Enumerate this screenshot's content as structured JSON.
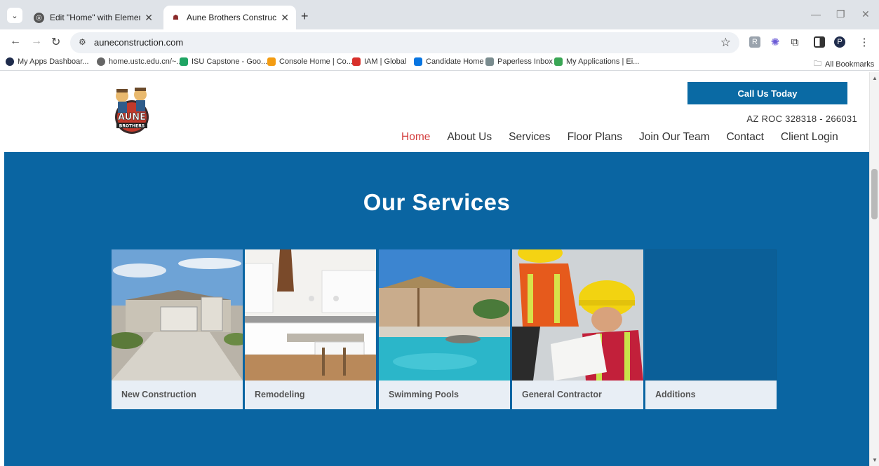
{
  "browser": {
    "tabs": [
      {
        "title": "Edit \"Home\" with Elementor",
        "active": false
      },
      {
        "title": "Aune Brothers Construction",
        "active": true
      }
    ],
    "url": "auneconstruction.com",
    "profile_initial": "P",
    "bookmarks": [
      {
        "label": "My Apps Dashboar...",
        "icon": "circle-icon",
        "color": "#1f2c4c"
      },
      {
        "label": "home.ustc.edu.cn/~...",
        "icon": "globe-icon",
        "color": "#666666"
      },
      {
        "label": "ISU Capstone - Goo...",
        "icon": "drive-icon",
        "color": "#1fa463"
      },
      {
        "label": "Console Home | Co...",
        "icon": "cube-icon",
        "color": "#f39c12"
      },
      {
        "label": "IAM | Global",
        "icon": "iam-icon",
        "color": "#d8302b"
      },
      {
        "label": "Candidate Home",
        "icon": "workday-icon",
        "color": "#0875e1"
      },
      {
        "label": "Paperless Inbox",
        "icon": "paperless-icon",
        "color": "#7a8c8f"
      },
      {
        "label": "My Applications | Ei...",
        "icon": "app-icon",
        "color": "#3aa655"
      }
    ],
    "all_bookmarks_label": "All Bookmarks"
  },
  "site": {
    "logo_text": "AUNE BROTHERS",
    "cta_label": "Call Us Today",
    "license": "AZ ROC 328318 - 266031",
    "nav": [
      "Home",
      "About Us",
      "Services",
      "Floor Plans",
      "Join Our Team",
      "Contact",
      "Client Login"
    ],
    "active_nav": "Home"
  },
  "services": {
    "heading": "Our Services",
    "cards": [
      {
        "label": "New Construction"
      },
      {
        "label": "Remodeling"
      },
      {
        "label": "Swimming Pools"
      },
      {
        "label": "General Contractor"
      },
      {
        "label": "Additions"
      }
    ]
  },
  "colors": {
    "brand_blue": "#0a65a2",
    "active_nav": "#d33b3b",
    "cta": "#0a6aa4"
  }
}
